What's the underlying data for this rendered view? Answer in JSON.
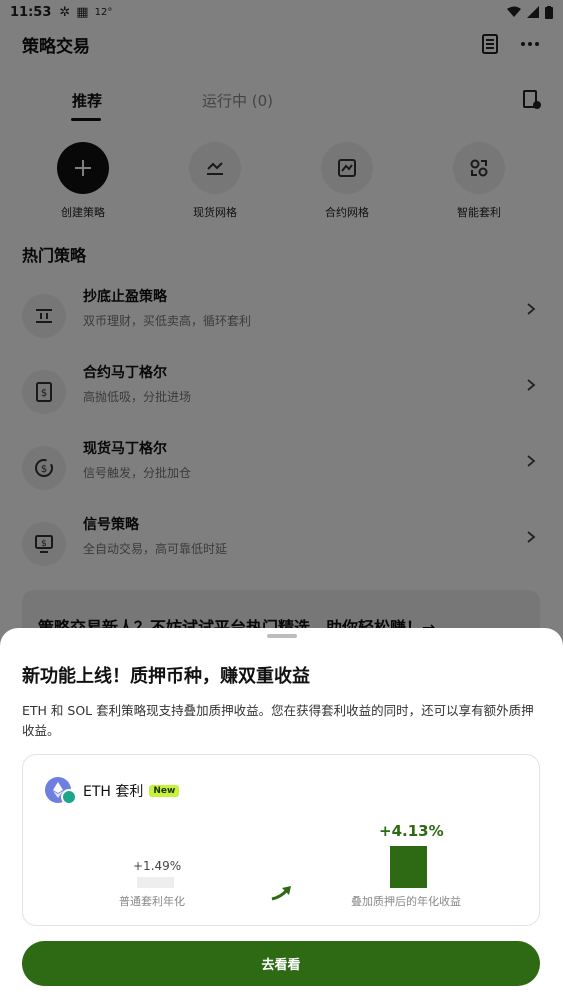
{
  "status": {
    "time": "11:53",
    "temp": "12°"
  },
  "header": {
    "title": "策略交易"
  },
  "tabs": [
    {
      "label": "推荐"
    },
    {
      "label": "运行中 (0)"
    }
  ],
  "quick": [
    {
      "label": "创建策略",
      "icon": "plus-icon"
    },
    {
      "label": "现货网格",
      "icon": "grid-chart-icon"
    },
    {
      "label": "合约网格",
      "icon": "contract-grid-icon"
    },
    {
      "label": "智能套利",
      "icon": "arbitrage-icon"
    }
  ],
  "section": {
    "title": "热门策略"
  },
  "strategies": [
    {
      "title": "抄底止盈策略",
      "sub": "双币理财，买低卖高，循环套利"
    },
    {
      "title": "合约马丁格尔",
      "sub": "高抛低吸，分批进场"
    },
    {
      "title": "现货马丁格尔",
      "sub": "信号触发，分批加仓"
    },
    {
      "title": "信号策略",
      "sub": "全自动交易，高可靠低时延"
    }
  ],
  "promo": {
    "text": "策略交易新人？不妨试试平台热门精选，助你轻松赚！→"
  },
  "sheet": {
    "title": "新功能上线！质押币种，赚双重收益",
    "desc": "ETH 和 SOL 套利策略现支持叠加质押收益。您在获得套利收益的同时，还可以享有额外质押收益。",
    "card": {
      "title": "ETH 套利",
      "badge": "New",
      "left_value": "+1.49%",
      "left_label": "普通套利年化",
      "right_value": "+4.13%",
      "right_label": "叠加质押后的年化收益"
    },
    "cta": "去看看"
  },
  "colors": {
    "accent": "#2e6a14",
    "badge": "#c7f13a"
  }
}
